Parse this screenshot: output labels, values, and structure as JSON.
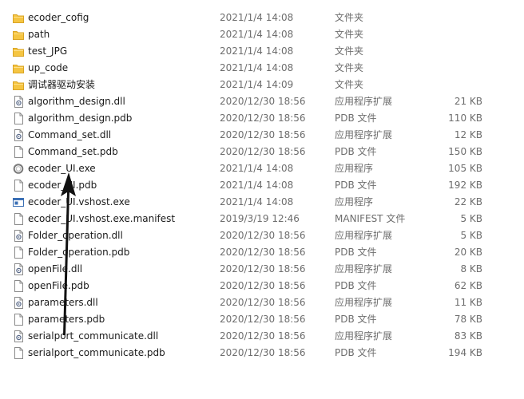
{
  "files": [
    {
      "name": "ecoder_cofig",
      "date": "2021/1/4 14:08",
      "type": "文件夹",
      "size": "",
      "icon": "folder-icon"
    },
    {
      "name": "path",
      "date": "2021/1/4 14:08",
      "type": "文件夹",
      "size": "",
      "icon": "folder-icon"
    },
    {
      "name": "test_JPG",
      "date": "2021/1/4 14:08",
      "type": "文件夹",
      "size": "",
      "icon": "folder-icon"
    },
    {
      "name": "up_code",
      "date": "2021/1/4 14:08",
      "type": "文件夹",
      "size": "",
      "icon": "folder-icon"
    },
    {
      "name": "调试器驱动安装",
      "date": "2021/1/4 14:09",
      "type": "文件夹",
      "size": "",
      "icon": "folder-icon"
    },
    {
      "name": "algorithm_design.dll",
      "date": "2020/12/30 18:56",
      "type": "应用程序扩展",
      "size": "21 KB",
      "icon": "dll-file-icon"
    },
    {
      "name": "algorithm_design.pdb",
      "date": "2020/12/30 18:56",
      "type": "PDB 文件",
      "size": "110 KB",
      "icon": "blank-file-icon"
    },
    {
      "name": "Command_set.dll",
      "date": "2020/12/30 18:56",
      "type": "应用程序扩展",
      "size": "12 KB",
      "icon": "dll-file-icon"
    },
    {
      "name": "Command_set.pdb",
      "date": "2020/12/30 18:56",
      "type": "PDB 文件",
      "size": "150 KB",
      "icon": "blank-file-icon"
    },
    {
      "name": "ecoder_UI.exe",
      "date": "2021/1/4 14:08",
      "type": "应用程序",
      "size": "105 KB",
      "icon": "app-ring-icon"
    },
    {
      "name": "ecoder_UI.pdb",
      "date": "2021/1/4 14:08",
      "type": "PDB 文件",
      "size": "192 KB",
      "icon": "blank-file-icon"
    },
    {
      "name": "ecoder_UI.vshost.exe",
      "date": "2021/1/4 14:08",
      "type": "应用程序",
      "size": "22 KB",
      "icon": "exe-window-icon"
    },
    {
      "name": "ecoder_UI.vshost.exe.manifest",
      "date": "2019/3/19 12:46",
      "type": "MANIFEST 文件",
      "size": "5 KB",
      "icon": "blank-file-icon"
    },
    {
      "name": "Folder_operation.dll",
      "date": "2020/12/30 18:56",
      "type": "应用程序扩展",
      "size": "5 KB",
      "icon": "dll-file-icon"
    },
    {
      "name": "Folder_operation.pdb",
      "date": "2020/12/30 18:56",
      "type": "PDB 文件",
      "size": "20 KB",
      "icon": "blank-file-icon"
    },
    {
      "name": "openFile.dll",
      "date": "2020/12/30 18:56",
      "type": "应用程序扩展",
      "size": "8 KB",
      "icon": "dll-file-icon"
    },
    {
      "name": "openFile.pdb",
      "date": "2020/12/30 18:56",
      "type": "PDB 文件",
      "size": "62 KB",
      "icon": "blank-file-icon"
    },
    {
      "name": "parameters.dll",
      "date": "2020/12/30 18:56",
      "type": "应用程序扩展",
      "size": "11 KB",
      "icon": "dll-file-icon"
    },
    {
      "name": "parameters.pdb",
      "date": "2020/12/30 18:56",
      "type": "PDB 文件",
      "size": "78 KB",
      "icon": "blank-file-icon"
    },
    {
      "name": "serialport_communicate.dll",
      "date": "2020/12/30 18:56",
      "type": "应用程序扩展",
      "size": "83 KB",
      "icon": "dll-file-icon"
    },
    {
      "name": "serialport_communicate.pdb",
      "date": "2020/12/30 18:56",
      "type": "PDB 文件",
      "size": "194 KB",
      "icon": "blank-file-icon"
    }
  ],
  "annotation": {
    "icon": "arrow-up-icon",
    "color": "#111111"
  },
  "colors": {
    "folder": "#f5c542",
    "text": "#1a1a1a",
    "meta": "#6d6d6d"
  }
}
